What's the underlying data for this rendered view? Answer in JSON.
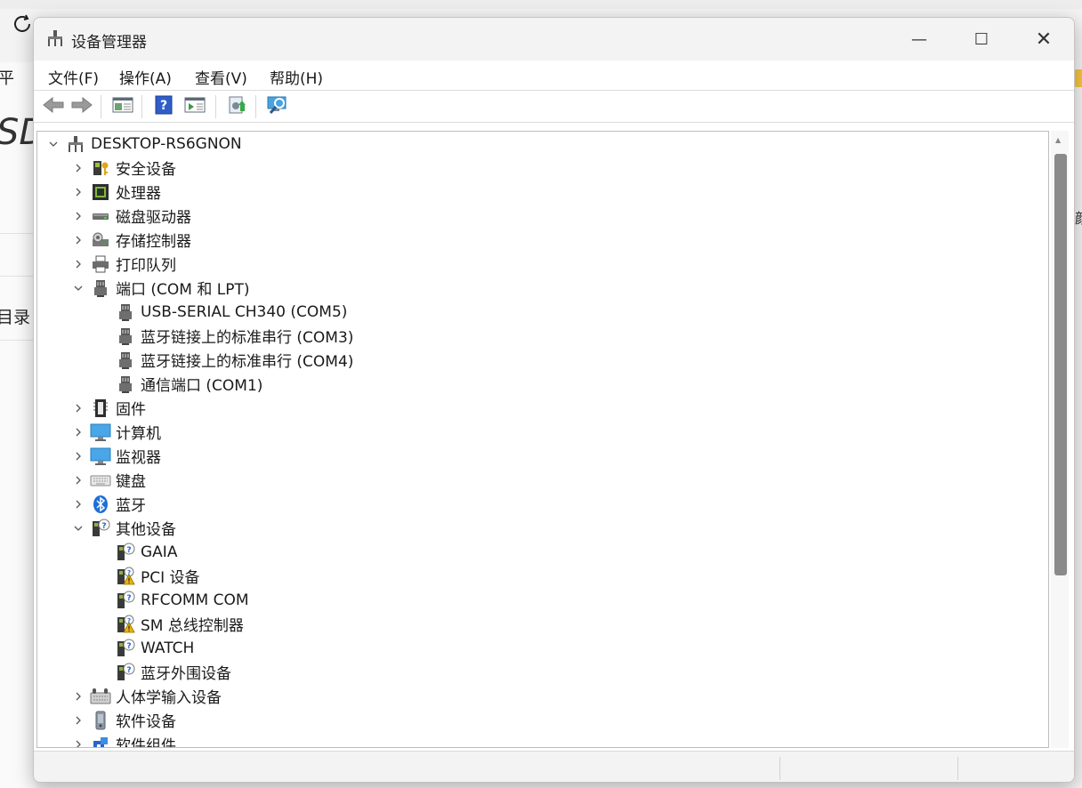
{
  "background": {
    "left_fragments": [
      "平",
      "SD",
      "目录"
    ],
    "right_fragment": "颜"
  },
  "window": {
    "title": "设备管理器",
    "controls": {
      "minimize": "—",
      "maximize": "☐",
      "close": "✕"
    }
  },
  "menu": [
    {
      "label": "文件(F)"
    },
    {
      "label": "操作(A)"
    },
    {
      "label": "查看(V)"
    },
    {
      "label": "帮助(H)"
    }
  ],
  "toolbar": {
    "buttons": [
      "back-icon",
      "forward-icon",
      "properties-icon",
      "help-icon",
      "run-icon",
      "update-driver-icon",
      "scan-hardware-icon"
    ]
  },
  "tree": {
    "root": "DESKTOP-RS6GNON",
    "items": [
      {
        "label": "安全设备",
        "icon": "security-device-icon",
        "expanded": false,
        "level": 1
      },
      {
        "label": "处理器",
        "icon": "processor-icon",
        "expanded": false,
        "level": 1
      },
      {
        "label": "磁盘驱动器",
        "icon": "disk-drive-icon",
        "expanded": false,
        "level": 1
      },
      {
        "label": "存储控制器",
        "icon": "storage-controller-icon",
        "expanded": false,
        "level": 1
      },
      {
        "label": "打印队列",
        "icon": "printer-icon",
        "expanded": false,
        "level": 1
      },
      {
        "label": "端口 (COM 和 LPT)",
        "icon": "port-icon",
        "expanded": true,
        "level": 1
      },
      {
        "label": "USB-SERIAL CH340 (COM5)",
        "icon": "port-icon",
        "level": 2
      },
      {
        "label": "蓝牙链接上的标准串行 (COM3)",
        "icon": "port-icon",
        "level": 2
      },
      {
        "label": "蓝牙链接上的标准串行 (COM4)",
        "icon": "port-icon",
        "level": 2
      },
      {
        "label": "通信端口 (COM1)",
        "icon": "port-icon",
        "level": 2
      },
      {
        "label": "固件",
        "icon": "firmware-icon",
        "expanded": false,
        "level": 1
      },
      {
        "label": "计算机",
        "icon": "computer-icon",
        "expanded": false,
        "level": 1
      },
      {
        "label": "监视器",
        "icon": "monitor-icon",
        "expanded": false,
        "level": 1
      },
      {
        "label": "键盘",
        "icon": "keyboard-icon",
        "expanded": false,
        "level": 1
      },
      {
        "label": "蓝牙",
        "icon": "bluetooth-icon",
        "expanded": false,
        "level": 1
      },
      {
        "label": "其他设备",
        "icon": "unknown-device-icon",
        "expanded": true,
        "level": 1
      },
      {
        "label": "GAIA",
        "icon": "unknown-device-icon",
        "level": 2
      },
      {
        "label": "PCI 设备",
        "icon": "warning-device-icon",
        "level": 2
      },
      {
        "label": "RFCOMM COM",
        "icon": "unknown-device-icon",
        "level": 2
      },
      {
        "label": "SM 总线控制器",
        "icon": "warning-device-icon",
        "level": 2
      },
      {
        "label": "WATCH",
        "icon": "unknown-device-icon",
        "level": 2
      },
      {
        "label": "蓝牙外围设备",
        "icon": "unknown-device-icon",
        "level": 2
      },
      {
        "label": "人体学输入设备",
        "icon": "hid-icon",
        "expanded": false,
        "level": 1
      },
      {
        "label": "软件设备",
        "icon": "software-device-icon",
        "expanded": false,
        "level": 1
      },
      {
        "label": "软件组件",
        "icon": "software-component-icon",
        "expanded": false,
        "level": 1
      }
    ]
  },
  "colors": {
    "window_bg": "#ffffff",
    "titlebar_bg": "#f3f3f3",
    "scroll_thumb": "#8a8a8a",
    "bluetooth": "#1e6fd6",
    "warning": "#f2b400"
  }
}
